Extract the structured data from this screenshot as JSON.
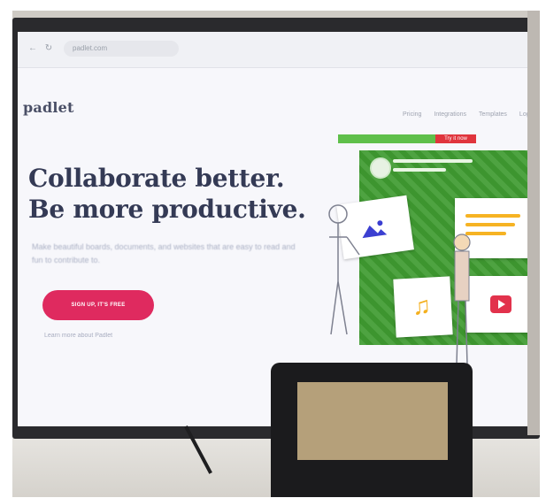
{
  "browser": {
    "address": "padlet.com"
  },
  "header": {
    "logo": "padlet",
    "nav": [
      "Pricing",
      "Integrations",
      "Templates",
      "Log in"
    ]
  },
  "hero": {
    "title_line1": "Collaborate better.",
    "title_line2": "Be more productive.",
    "subtitle": "Make beautiful boards, documents, and websites that are easy to read and fun to contribute to.",
    "cta_label": "SIGN UP, IT'S FREE",
    "secondary_link": "Learn more about Padlet"
  },
  "illustration": {
    "promo_label": "Try it now",
    "icons": [
      "image-icon",
      "text-icon",
      "music-icon",
      "video-play-icon"
    ],
    "colors": {
      "board": "#3f9b31",
      "accent": "#df2a5f",
      "music": "#f4b020",
      "video": "#e2324c"
    }
  }
}
